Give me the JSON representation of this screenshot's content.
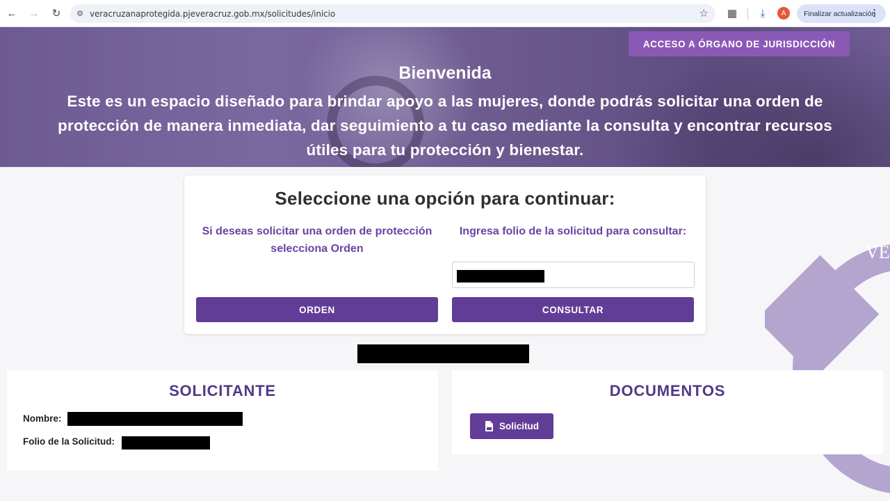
{
  "browser": {
    "url": "veracruzanaprotegida.pjeveracruz.gob.mx/solicitudes/inicio",
    "avatar_letter": "A",
    "update_label": "Finalizar actualización"
  },
  "hero": {
    "access_label": "ACCESO A ÓRGANO DE JURISDICCIÓN",
    "title": "Bienvenida",
    "text": "Este es un espacio diseñado para brindar apoyo a las mujeres, donde podrás solicitar una orden de protección de manera inmediata, dar seguimiento a tu caso mediante la consulta y encontrar recursos útiles para tu protección y bienestar."
  },
  "emblem": {
    "text": "VE"
  },
  "options": {
    "title": "Seleccione una opción para continuar:",
    "left_text": "Si deseas solicitar una orden de protección selecciona Orden",
    "right_text": "Ingresa folio de la solicitud para consultar:",
    "folio_value": "",
    "orden_label": "ORDEN",
    "consultar_label": "CONSULTAR"
  },
  "solicitante": {
    "title": "SOLICITANTE",
    "nombre_label": "Nombre:",
    "folio_label": "Folio de la Solicitud:"
  },
  "documentos": {
    "title": "DOCUMENTOS",
    "solicitud_label": "Solicitud"
  },
  "colors": {
    "brand_purple": "#623d97",
    "accent_purple": "#8a59b6",
    "title_purple": "#4f3a86"
  }
}
